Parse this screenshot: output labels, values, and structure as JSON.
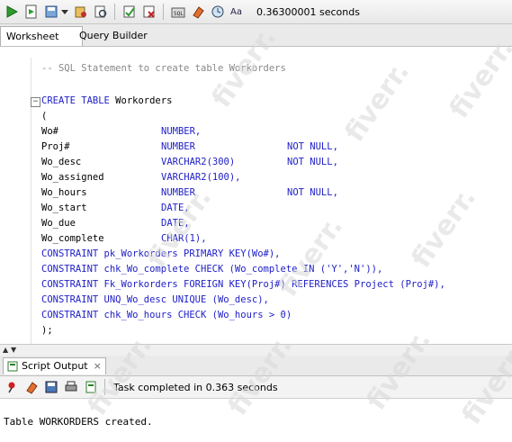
{
  "toolbar": {
    "icons": [
      "run-statement-icon",
      "run-script-icon",
      "commit-icon",
      "dropdown-icon",
      "autotrace-icon",
      "explain-plan-icon",
      "rollback-icon",
      "clear-icon",
      "sql-tuning-icon",
      "eraser-icon",
      "history-icon",
      "format-case-icon"
    ],
    "elapsed_time": "0.36300001 seconds"
  },
  "tabs": [
    {
      "label": "Worksheet",
      "active": true
    },
    {
      "label": "Query Builder",
      "active": false
    }
  ],
  "editor": {
    "comment": "-- SQL Statement to create table Workorders",
    "create_kw": "CREATE TABLE",
    "table_name": " Workorders",
    "open_paren": "(",
    "columns": [
      {
        "name": "Wo#",
        "type": "NUMBER,",
        "constraint": ""
      },
      {
        "name": "Proj#",
        "type": "NUMBER",
        "constraint": "NOT NULL,"
      },
      {
        "name": "Wo_desc",
        "type": "VARCHAR2(300)",
        "constraint": "NOT NULL,"
      },
      {
        "name": "Wo_assigned",
        "type": "VARCHAR2(100),",
        "constraint": ""
      },
      {
        "name": "Wo_hours",
        "type": "NUMBER",
        "constraint": "NOT NULL,"
      },
      {
        "name": "Wo_start",
        "type": "DATE,",
        "constraint": ""
      },
      {
        "name": "Wo_due",
        "type": "DATE,",
        "constraint": ""
      },
      {
        "name": "Wo_complete",
        "type": "CHAR(1),",
        "constraint": ""
      }
    ],
    "constraints": [
      "CONSTRAINT pk_Workorders PRIMARY KEY(Wo#),",
      "CONSTRAINT chk_Wo_complete CHECK (Wo_complete IN ('Y','N')),",
      "CONSTRAINT Fk_Workorders FOREIGN KEY(Proj#) REFERENCES Project (Proj#),",
      "CONSTRAINT UNQ_Wo_desc UNIQUE (Wo_desc),",
      "CONSTRAINT chk_Wo_hours CHECK (Wo_hours > 0)"
    ],
    "close": ");"
  },
  "output_panel": {
    "tab_label": "Script Output",
    "close_label": "×",
    "status": "Task completed in 0.363 seconds",
    "result": "Table WORKORDERS created."
  },
  "colors": {
    "keyword": "#2020c8",
    "comment": "#888888",
    "run_green": "#2e9b2e"
  },
  "watermark": "fiverr."
}
